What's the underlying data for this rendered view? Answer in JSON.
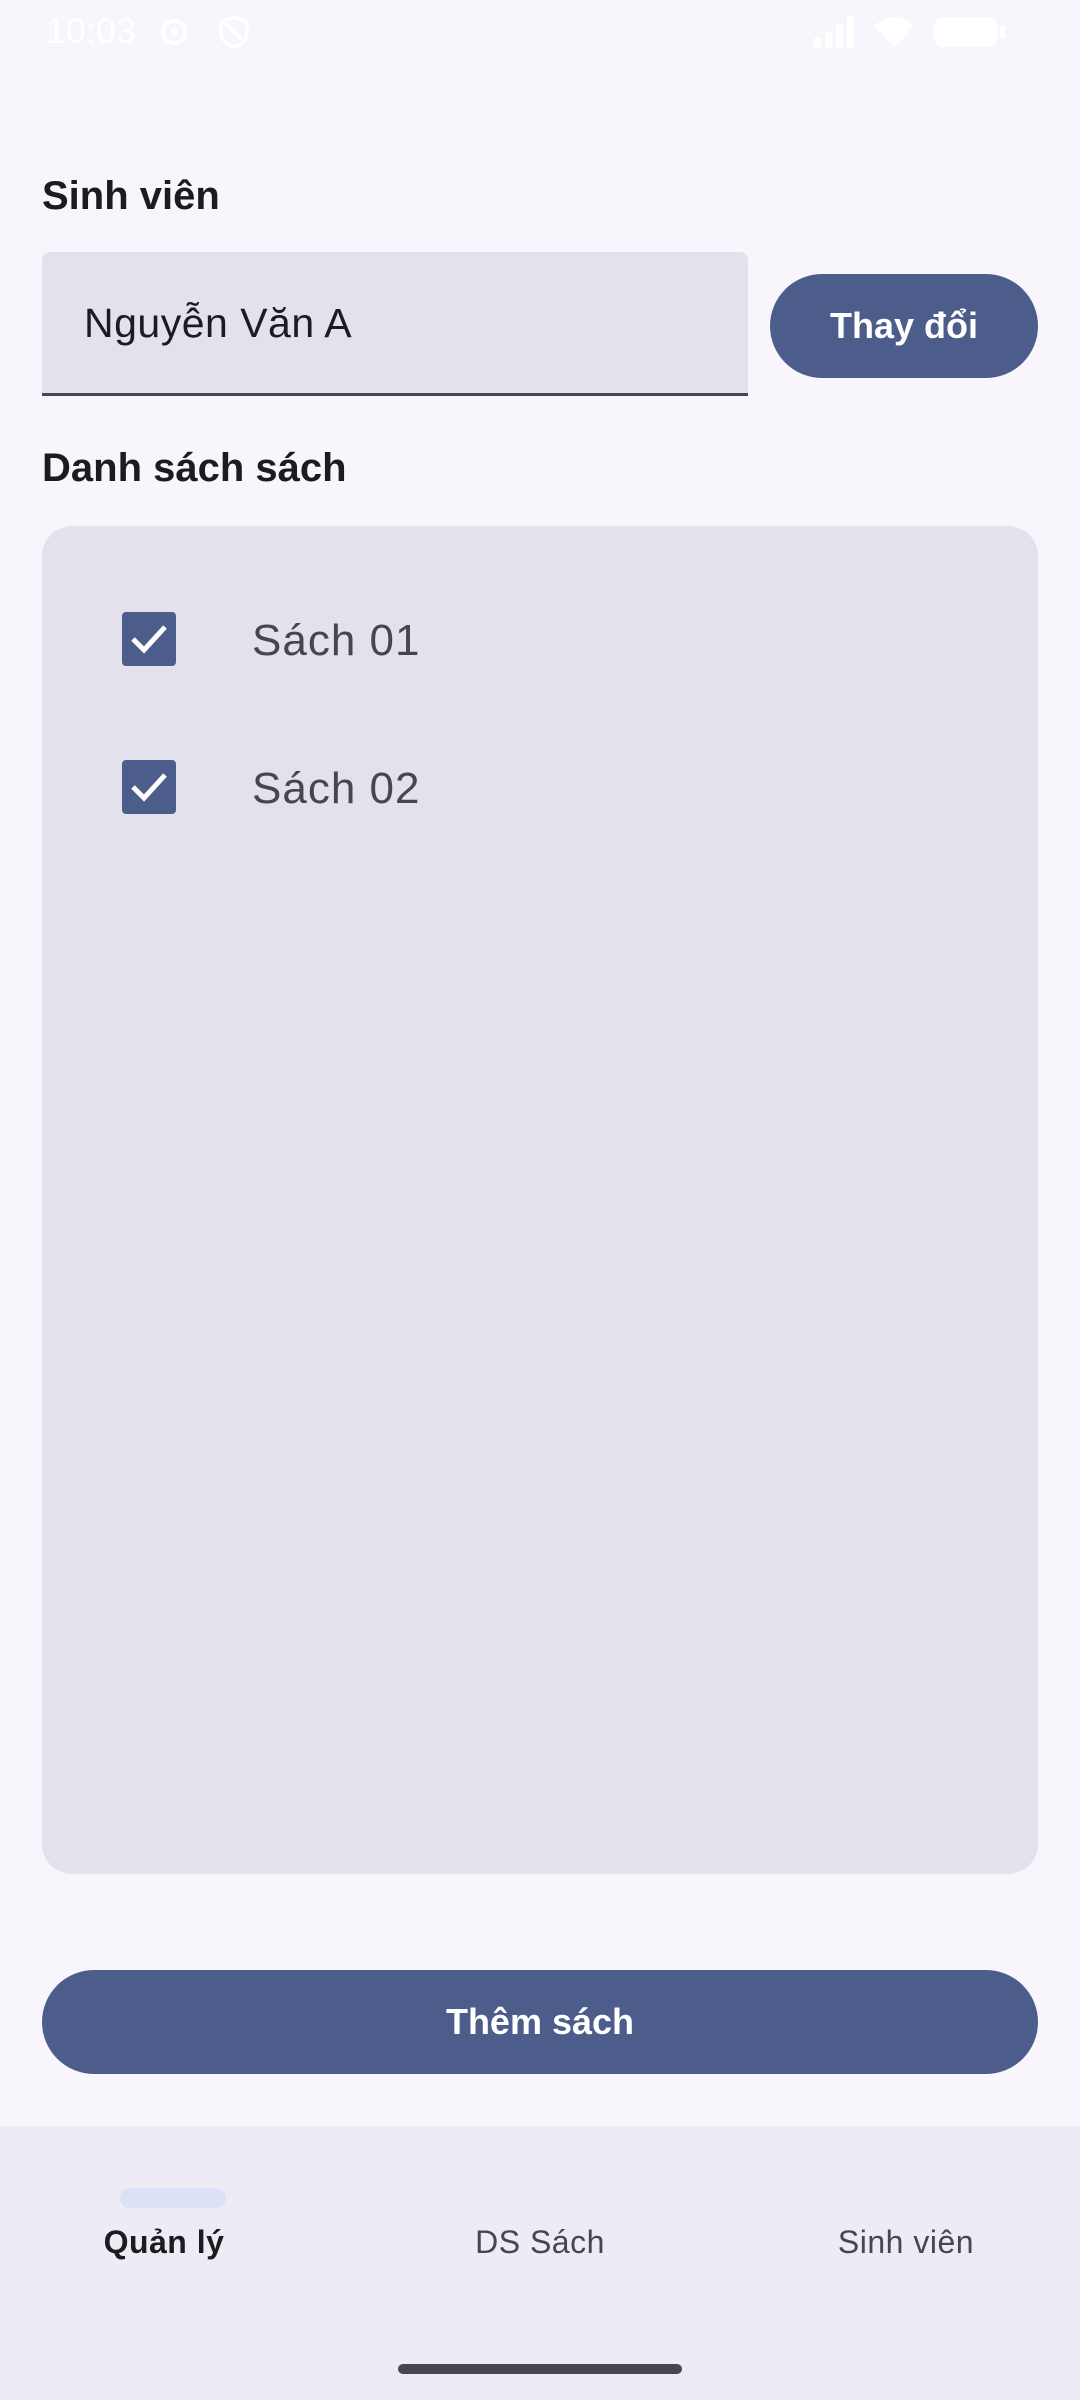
{
  "status_bar": {
    "time": "10:03",
    "icons": [
      "gear-icon",
      "shield-icon",
      "signal-icon",
      "wifi-icon",
      "battery-icon"
    ]
  },
  "student_section": {
    "title": "Sinh viên",
    "field_value": "Nguyễn Văn A",
    "change_button": "Thay đổi"
  },
  "books_section": {
    "title": "Danh sách sách",
    "items": [
      {
        "label": "Sách 01",
        "checked": true
      },
      {
        "label": "Sách 02",
        "checked": true
      }
    ]
  },
  "add_button": "Thêm sách",
  "bottom_nav": {
    "items": [
      {
        "label": "Quản lý",
        "active": true
      },
      {
        "label": "DS Sách",
        "active": false
      },
      {
        "label": "Sinh viên",
        "active": false
      }
    ]
  },
  "colors": {
    "primary": "#4d5d8b",
    "surface_container": "#e2e1ec",
    "background": "#f8f6fc",
    "nav_background": "#edecf5",
    "indicator": "#dde1f8"
  }
}
